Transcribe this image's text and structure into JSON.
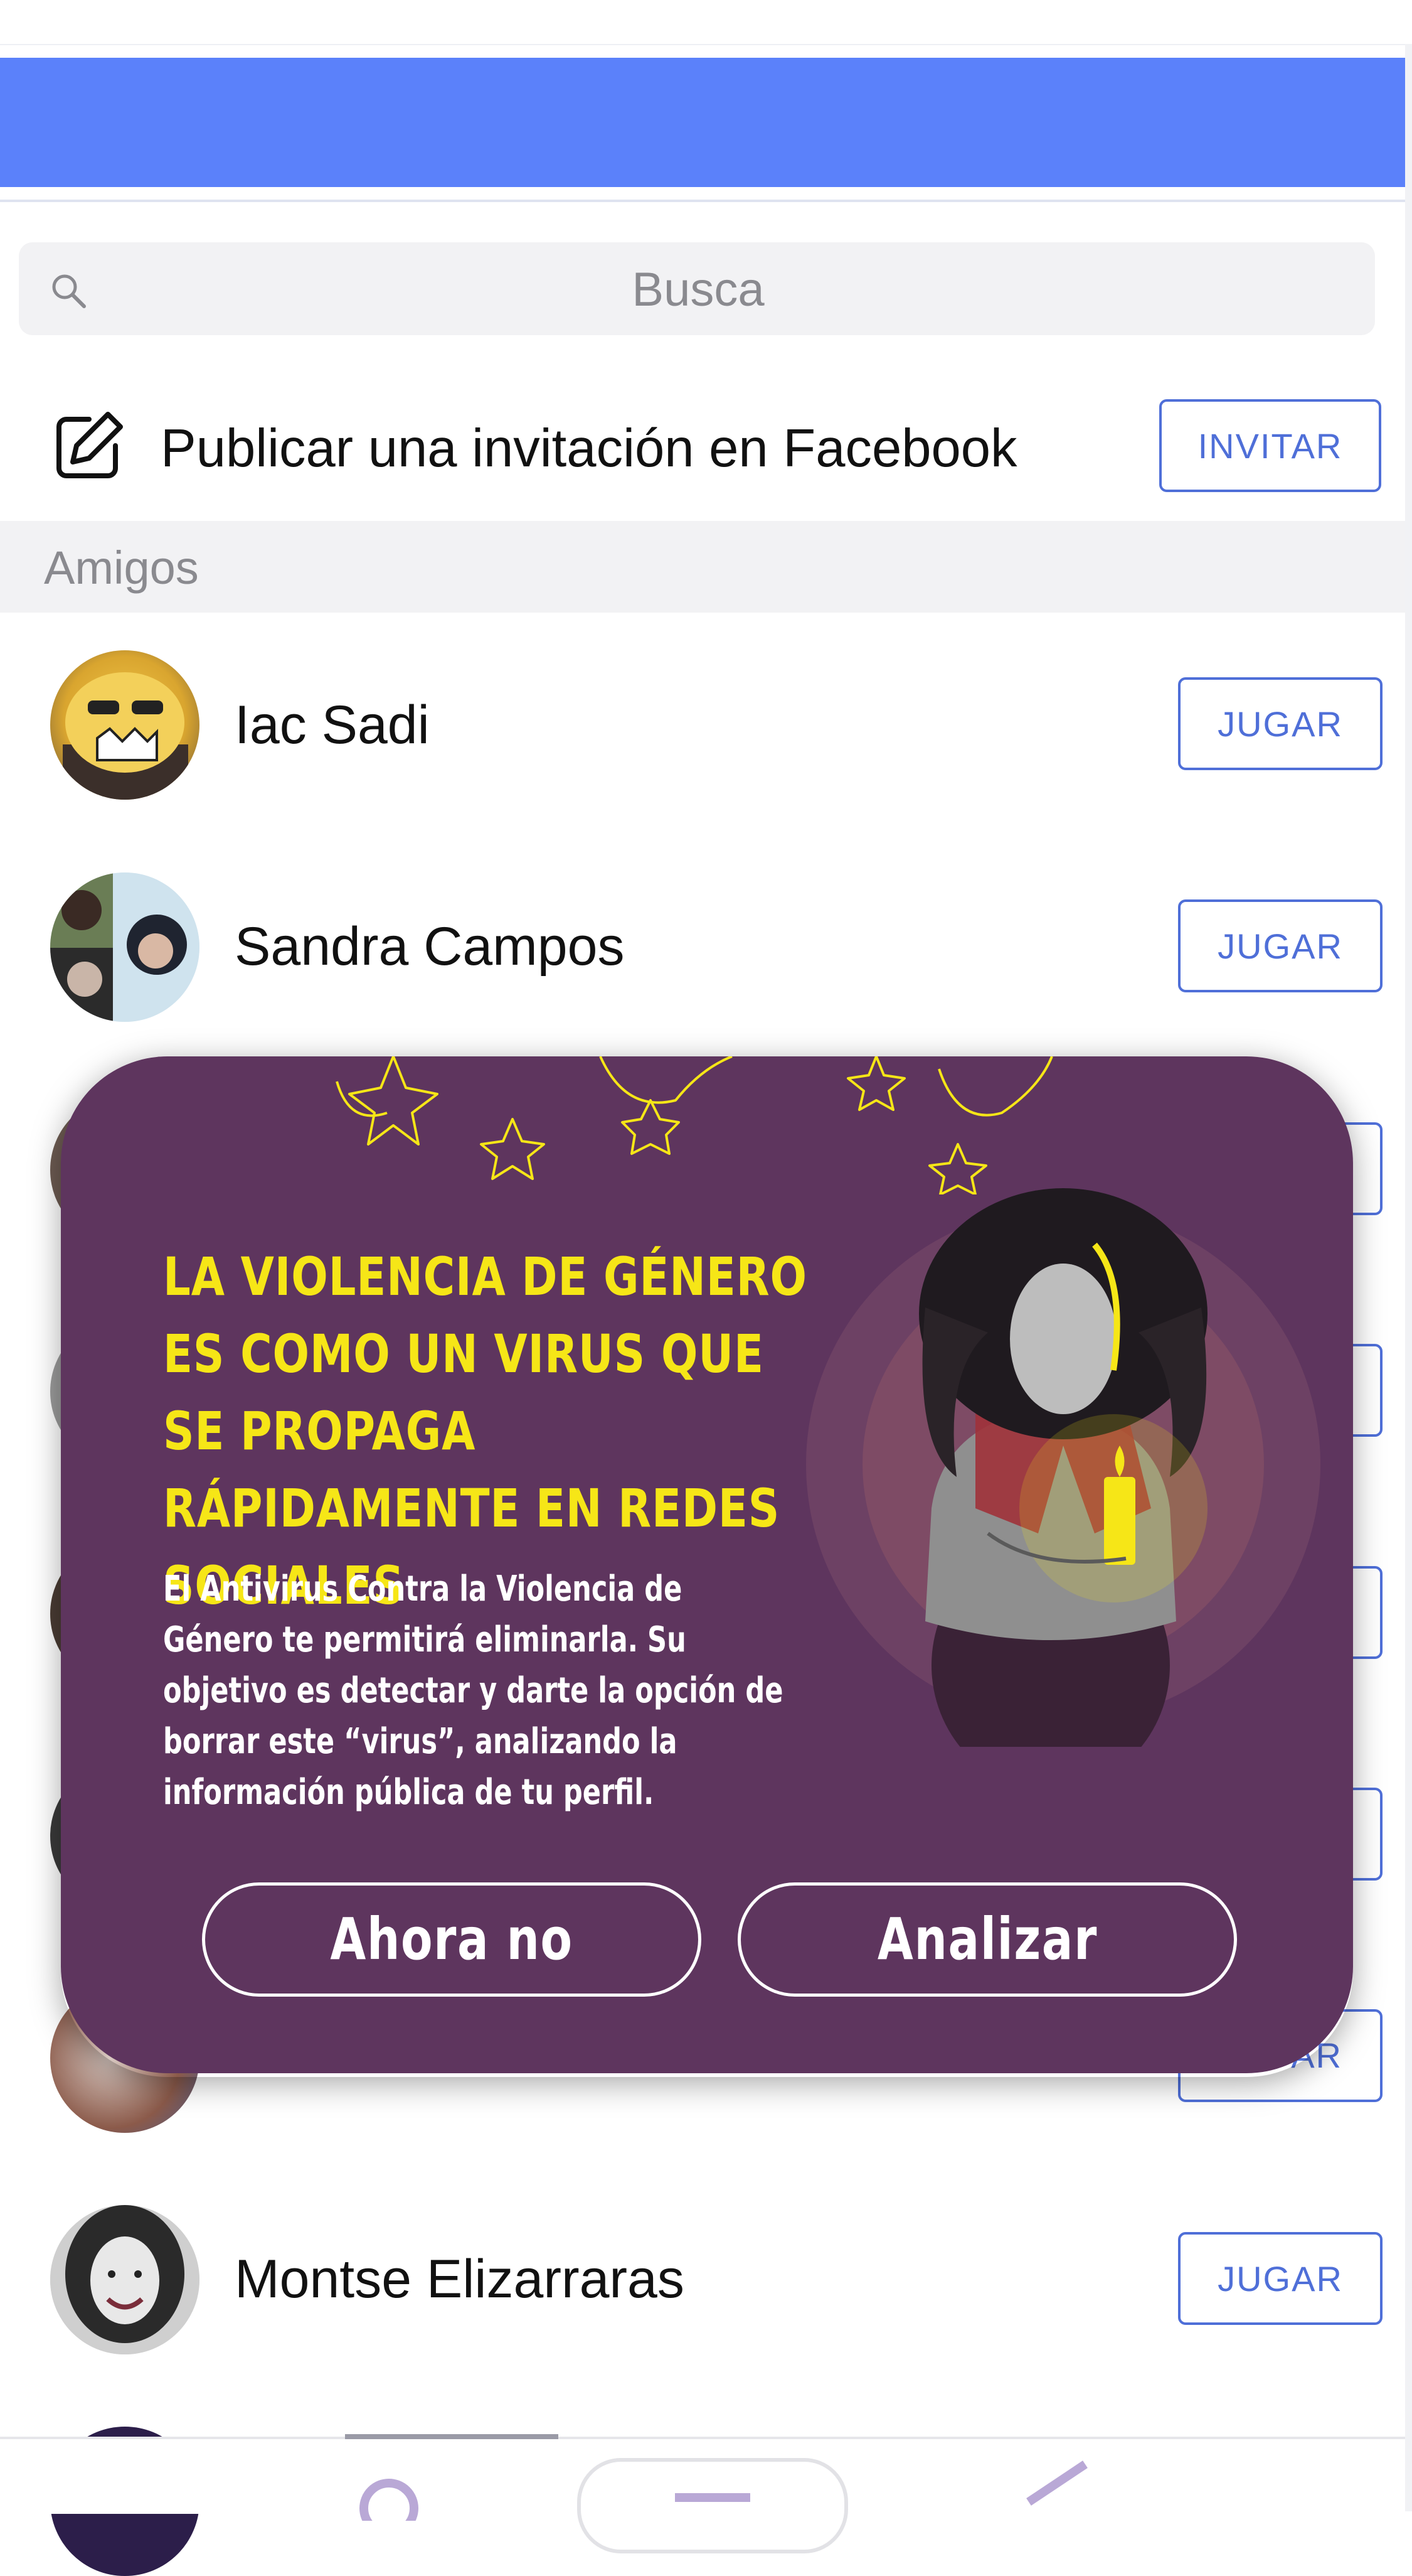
{
  "search": {
    "placeholder": "Busca"
  },
  "invite_row": {
    "label": "Publicar una invitación en Facebook",
    "button": "INVITAR"
  },
  "section": {
    "title": "Amigos"
  },
  "friends": [
    {
      "name": "Iac Sadi",
      "button": "JUGAR"
    },
    {
      "name": "Sandra Campos",
      "button": "JUGAR"
    },
    {
      "name": "Montse Elizarraras",
      "button": "JUGAR"
    }
  ],
  "partial_buttons": {
    "b7": "AR"
  },
  "modal": {
    "title": "LA VIOLENCIA DE GÉNERO ES COMO UN VIRUS QUE SE PROPAGA RÁPIDAMENTE EN REDES SOCIALES",
    "body": "El Antivirus Contra la Violencia de Género te permitirá eliminarla. Su objetivo es detectar y darte la opción de borrar este “virus”, analizando la información pública de tu perfil.",
    "not_now": "Ahora no",
    "analyze": "Analizar"
  },
  "colors": {
    "header": "#5b81fa",
    "accent": "#4f6fd8",
    "modal_bg": "#5e355e",
    "modal_title": "#f6e617"
  }
}
